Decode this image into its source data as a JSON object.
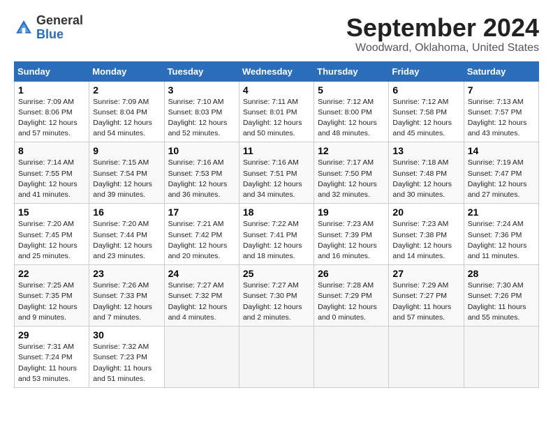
{
  "header": {
    "logo_line1": "General",
    "logo_line2": "Blue",
    "month": "September 2024",
    "location": "Woodward, Oklahoma, United States"
  },
  "columns": [
    "Sunday",
    "Monday",
    "Tuesday",
    "Wednesday",
    "Thursday",
    "Friday",
    "Saturday"
  ],
  "weeks": [
    [
      {
        "day": "1",
        "sunrise": "7:09 AM",
        "sunset": "8:06 PM",
        "daylight": "12 hours and 57 minutes."
      },
      {
        "day": "2",
        "sunrise": "7:09 AM",
        "sunset": "8:04 PM",
        "daylight": "12 hours and 54 minutes."
      },
      {
        "day": "3",
        "sunrise": "7:10 AM",
        "sunset": "8:03 PM",
        "daylight": "12 hours and 52 minutes."
      },
      {
        "day": "4",
        "sunrise": "7:11 AM",
        "sunset": "8:01 PM",
        "daylight": "12 hours and 50 minutes."
      },
      {
        "day": "5",
        "sunrise": "7:12 AM",
        "sunset": "8:00 PM",
        "daylight": "12 hours and 48 minutes."
      },
      {
        "day": "6",
        "sunrise": "7:12 AM",
        "sunset": "7:58 PM",
        "daylight": "12 hours and 45 minutes."
      },
      {
        "day": "7",
        "sunrise": "7:13 AM",
        "sunset": "7:57 PM",
        "daylight": "12 hours and 43 minutes."
      }
    ],
    [
      {
        "day": "8",
        "sunrise": "7:14 AM",
        "sunset": "7:55 PM",
        "daylight": "12 hours and 41 minutes."
      },
      {
        "day": "9",
        "sunrise": "7:15 AM",
        "sunset": "7:54 PM",
        "daylight": "12 hours and 39 minutes."
      },
      {
        "day": "10",
        "sunrise": "7:16 AM",
        "sunset": "7:53 PM",
        "daylight": "12 hours and 36 minutes."
      },
      {
        "day": "11",
        "sunrise": "7:16 AM",
        "sunset": "7:51 PM",
        "daylight": "12 hours and 34 minutes."
      },
      {
        "day": "12",
        "sunrise": "7:17 AM",
        "sunset": "7:50 PM",
        "daylight": "12 hours and 32 minutes."
      },
      {
        "day": "13",
        "sunrise": "7:18 AM",
        "sunset": "7:48 PM",
        "daylight": "12 hours and 30 minutes."
      },
      {
        "day": "14",
        "sunrise": "7:19 AM",
        "sunset": "7:47 PM",
        "daylight": "12 hours and 27 minutes."
      }
    ],
    [
      {
        "day": "15",
        "sunrise": "7:20 AM",
        "sunset": "7:45 PM",
        "daylight": "12 hours and 25 minutes."
      },
      {
        "day": "16",
        "sunrise": "7:20 AM",
        "sunset": "7:44 PM",
        "daylight": "12 hours and 23 minutes."
      },
      {
        "day": "17",
        "sunrise": "7:21 AM",
        "sunset": "7:42 PM",
        "daylight": "12 hours and 20 minutes."
      },
      {
        "day": "18",
        "sunrise": "7:22 AM",
        "sunset": "7:41 PM",
        "daylight": "12 hours and 18 minutes."
      },
      {
        "day": "19",
        "sunrise": "7:23 AM",
        "sunset": "7:39 PM",
        "daylight": "12 hours and 16 minutes."
      },
      {
        "day": "20",
        "sunrise": "7:23 AM",
        "sunset": "7:38 PM",
        "daylight": "12 hours and 14 minutes."
      },
      {
        "day": "21",
        "sunrise": "7:24 AM",
        "sunset": "7:36 PM",
        "daylight": "12 hours and 11 minutes."
      }
    ],
    [
      {
        "day": "22",
        "sunrise": "7:25 AM",
        "sunset": "7:35 PM",
        "daylight": "12 hours and 9 minutes."
      },
      {
        "day": "23",
        "sunrise": "7:26 AM",
        "sunset": "7:33 PM",
        "daylight": "12 hours and 7 minutes."
      },
      {
        "day": "24",
        "sunrise": "7:27 AM",
        "sunset": "7:32 PM",
        "daylight": "12 hours and 4 minutes."
      },
      {
        "day": "25",
        "sunrise": "7:27 AM",
        "sunset": "7:30 PM",
        "daylight": "12 hours and 2 minutes."
      },
      {
        "day": "26",
        "sunrise": "7:28 AM",
        "sunset": "7:29 PM",
        "daylight": "12 hours and 0 minutes."
      },
      {
        "day": "27",
        "sunrise": "7:29 AM",
        "sunset": "7:27 PM",
        "daylight": "11 hours and 57 minutes."
      },
      {
        "day": "28",
        "sunrise": "7:30 AM",
        "sunset": "7:26 PM",
        "daylight": "11 hours and 55 minutes."
      }
    ],
    [
      {
        "day": "29",
        "sunrise": "7:31 AM",
        "sunset": "7:24 PM",
        "daylight": "11 hours and 53 minutes."
      },
      {
        "day": "30",
        "sunrise": "7:32 AM",
        "sunset": "7:23 PM",
        "daylight": "11 hours and 51 minutes."
      },
      null,
      null,
      null,
      null,
      null
    ]
  ]
}
